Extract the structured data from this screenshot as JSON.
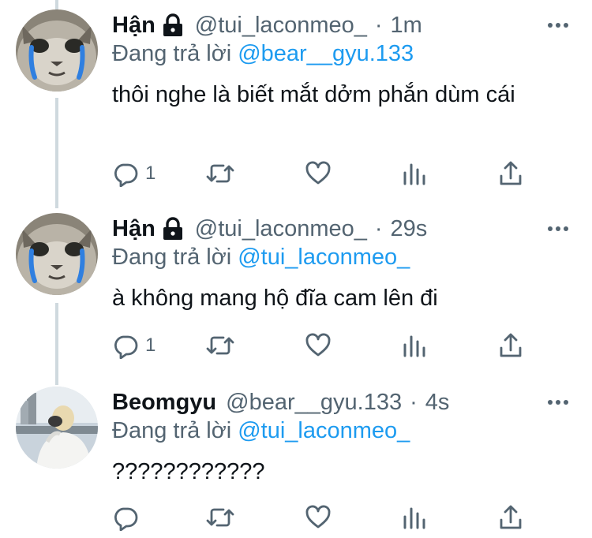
{
  "colors": {
    "name": "#0f1419",
    "meta": "#536471",
    "mention": "#1d9bf0",
    "thread_line": "#cfd9de"
  },
  "tweets": [
    {
      "name": "Hận",
      "locked": true,
      "handle": "@tui_laconmeo_",
      "separator": "·",
      "time": "1m",
      "reply_prefix": "Đang trả lời",
      "reply_to": "@bear__gyu.133",
      "text": "thôi nghe là biết mắt dởm phắn dùm cái",
      "reply_count": "1",
      "avatar": "crying-cat-avatar"
    },
    {
      "name": "Hận",
      "locked": true,
      "handle": "@tui_laconmeo_",
      "separator": "·",
      "time": "29s",
      "reply_prefix": "Đang trả lời",
      "reply_to": "@tui_laconmeo_",
      "text": "à không mang hộ đĩa cam lên đi",
      "reply_count": "1",
      "avatar": "crying-cat-avatar"
    },
    {
      "name": "Beomgyu",
      "locked": false,
      "handle": "@bear__gyu.133",
      "separator": "·",
      "time": "4s",
      "reply_prefix": "Đang trả lời",
      "reply_to": "@tui_laconmeo_",
      "text": "????????????",
      "reply_count": "",
      "avatar": "person-photo-avatar"
    }
  ],
  "icons": {
    "more": "more-dots-icon",
    "lock": "lock-icon",
    "reply": "reply-icon",
    "retweet": "retweet-icon",
    "like": "heart-icon",
    "analytics": "analytics-icon",
    "share": "share-icon"
  }
}
